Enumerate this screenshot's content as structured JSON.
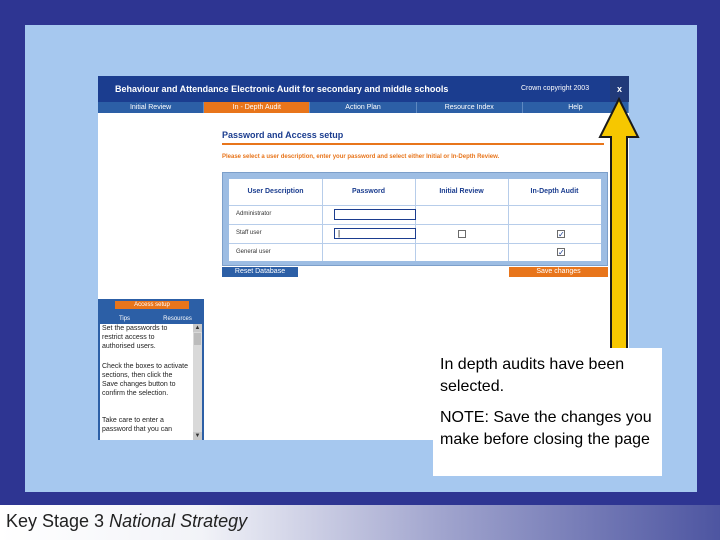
{
  "app": {
    "title": "Behaviour and Attendance Electronic Audit for secondary and middle schools",
    "copyright": "Crown copyright 2003",
    "close_label": "x"
  },
  "nav": {
    "tabs": [
      {
        "label": "Initial Review",
        "active": false
      },
      {
        "label": "In - Depth Audit",
        "active": true
      },
      {
        "label": "Action Plan",
        "active": false
      },
      {
        "label": "Resource Index",
        "active": false
      },
      {
        "label": "Help",
        "active": false
      }
    ]
  },
  "main": {
    "heading": "Password and Access setup",
    "instruction": "Please select a user description, enter your password and select either Initial or In-Depth Review.",
    "columns": [
      "User Description",
      "Password",
      "Initial Review",
      "In-Depth Audit"
    ],
    "rows": [
      {
        "role": "Administrator",
        "password": "",
        "initial_review": null,
        "in_depth_audit": null
      },
      {
        "role": "Staff user",
        "password": "|",
        "initial_review": false,
        "in_depth_audit": true
      },
      {
        "role": "General user",
        "password": null,
        "initial_review": null,
        "in_depth_audit": true
      }
    ],
    "reset_label": "Reset Database",
    "save_label": "Save changes"
  },
  "side": {
    "section_label": "Access setup",
    "tabs": [
      "Tips",
      "Resources"
    ],
    "tips": [
      "Set the passwords to restrict access to authorised users.",
      "Check the boxes to activate sections, then click the Save changes button to confirm the selection.",
      "Take care to enter a password that you can"
    ]
  },
  "callout": {
    "line1": "In depth audits have been selected.",
    "line2": "NOTE: Save the changes you make before closing the page"
  },
  "footer": {
    "key_stage": "Key Stage 3",
    "strategy": "National Strategy"
  },
  "colors": {
    "background": "#2e3592",
    "slide": "#a6c8ef",
    "titlebar": "#1b3d8f",
    "accent": "#e8751b",
    "arrow": "#f6c700"
  }
}
